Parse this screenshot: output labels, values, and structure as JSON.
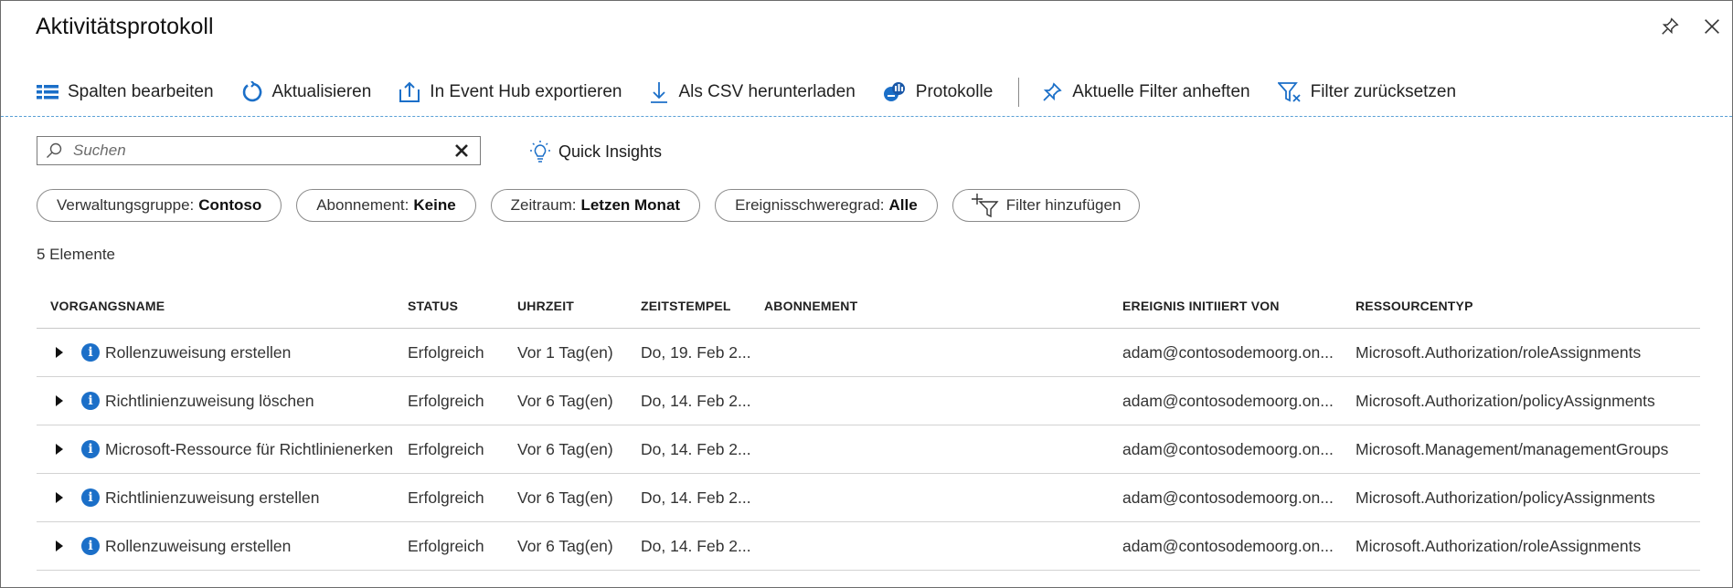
{
  "window": {
    "title": "Aktivitätsprotokoll",
    "icons": [
      "pin-icon",
      "close-icon"
    ]
  },
  "toolbar": {
    "edit_columns": "Spalten bearbeiten",
    "refresh": "Aktualisieren",
    "export_event_hub": "In Event Hub exportieren",
    "download_csv": "Als CSV herunterladen",
    "logs": "Protokolle",
    "pin_filters": "Aktuelle Filter anheften",
    "reset_filters": "Filter zurücksetzen"
  },
  "search": {
    "placeholder": "Suchen",
    "value": ""
  },
  "quick_insights": "Quick Insights",
  "filters": [
    {
      "label": "Verwaltungsgruppe:",
      "value": "Contoso"
    },
    {
      "label": "Abonnement:",
      "value": "Keine"
    },
    {
      "label": "Zeitraum:",
      "value": "Letzen Monat"
    },
    {
      "label": "Ereignisschweregrad:",
      "value": "Alle"
    }
  ],
  "add_filter": "Filter hinzufügen",
  "item_count": "5 Elemente",
  "columns": [
    "VORGANGSNAME",
    "STATUS",
    "UHRZEIT",
    "ZEITSTEMPEL",
    "ABONNEMENT",
    "EREIGNIS INITIIERT VON",
    "RESSOURCENTYP"
  ],
  "rows": [
    {
      "name": "Rollenzuweisung erstellen",
      "status": "Erfolgreich",
      "time": "Vor 1 Tag(en)",
      "timestamp": "Do, 19. Feb 2...",
      "subscription": "",
      "initiated_by": "adam@contosodemoorg.on...",
      "resource_type": "Microsoft.Authorization/roleAssignments"
    },
    {
      "name": "Richtlinienzuweisung löschen",
      "status": "Erfolgreich",
      "time": "Vor 6 Tag(en)",
      "timestamp": "Do, 14. Feb 2...",
      "subscription": "",
      "initiated_by": "adam@contosodemoorg.on...",
      "resource_type": "Microsoft.Authorization/policyAssignments"
    },
    {
      "name": "Microsoft-Ressource für Richtlinienerken",
      "status": "Erfolgreich",
      "time": "Vor 6 Tag(en)",
      "timestamp": "Do, 14. Feb 2...",
      "subscription": "",
      "initiated_by": "adam@contosodemoorg.on...",
      "resource_type": "Microsoft.Management/managementGroups"
    },
    {
      "name": "Richtlinienzuweisung erstellen",
      "status": "Erfolgreich",
      "time": "Vor 6 Tag(en)",
      "timestamp": "Do, 14. Feb 2...",
      "subscription": "",
      "initiated_by": "adam@contosodemoorg.on...",
      "resource_type": "Microsoft.Authorization/policyAssignments"
    },
    {
      "name": "Rollenzuweisung erstellen",
      "status": "Erfolgreich",
      "time": "Vor 6 Tag(en)",
      "timestamp": "Do, 14. Feb 2...",
      "subscription": "",
      "initiated_by": "adam@contosodemoorg.on...",
      "resource_type": "Microsoft.Authorization/roleAssignments"
    }
  ],
  "colors": {
    "accent": "#1b6fc8",
    "separator": "#5aa0d6"
  }
}
